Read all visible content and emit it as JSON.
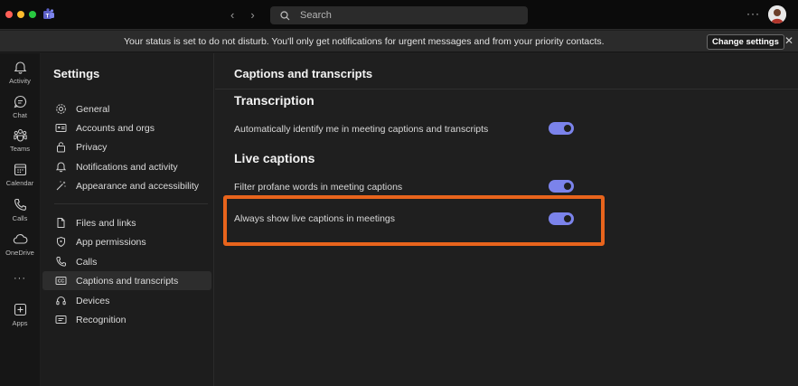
{
  "titlebar": {
    "search_placeholder": "Search",
    "more": "···"
  },
  "banner": {
    "message": "Your status is set to do not disturb. You'll only get notifications for urgent messages and from your priority contacts.",
    "change_settings": "Change settings",
    "close": "✕"
  },
  "rail": {
    "items": [
      {
        "label": "Activity",
        "icon": "bell-icon"
      },
      {
        "label": "Chat",
        "icon": "chat-icon"
      },
      {
        "label": "Teams",
        "icon": "teams-icon"
      },
      {
        "label": "Calendar",
        "icon": "calendar-icon"
      },
      {
        "label": "Calls",
        "icon": "phone-icon"
      },
      {
        "label": "OneDrive",
        "icon": "cloud-icon"
      },
      {
        "label": "Apps",
        "icon": "apps-icon"
      }
    ],
    "more": "···"
  },
  "settings": {
    "title": "Settings",
    "items": [
      {
        "label": "General",
        "icon": "gear-icon"
      },
      {
        "label": "Accounts and orgs",
        "icon": "id-card-icon"
      },
      {
        "label": "Privacy",
        "icon": "lock-icon"
      },
      {
        "label": "Notifications and activity",
        "icon": "bell-icon"
      },
      {
        "label": "Appearance and accessibility",
        "icon": "wand-icon"
      },
      {
        "label": "Files and links",
        "icon": "file-icon"
      },
      {
        "label": "App permissions",
        "icon": "shield-icon"
      },
      {
        "label": "Calls",
        "icon": "phone-icon"
      },
      {
        "label": "Captions and transcripts",
        "icon": "cc-icon"
      },
      {
        "label": "Devices",
        "icon": "headset-icon"
      },
      {
        "label": "Recognition",
        "icon": "recognition-icon"
      }
    ],
    "active": "Captions and transcripts"
  },
  "main": {
    "title": "Captions and transcripts",
    "sections": [
      {
        "title": "Transcription",
        "settings": [
          {
            "label": "Automatically identify me in meeting captions and transcripts",
            "enabled": true
          }
        ]
      },
      {
        "title": "Live captions",
        "settings": [
          {
            "label": "Filter profane words in meeting captions",
            "enabled": true
          },
          {
            "label": "Always show live captions in meetings",
            "enabled": true
          }
        ]
      }
    ]
  },
  "colors": {
    "accent": "#7b83eb",
    "highlight": "#e8641c",
    "background": "#1f1f1f"
  }
}
